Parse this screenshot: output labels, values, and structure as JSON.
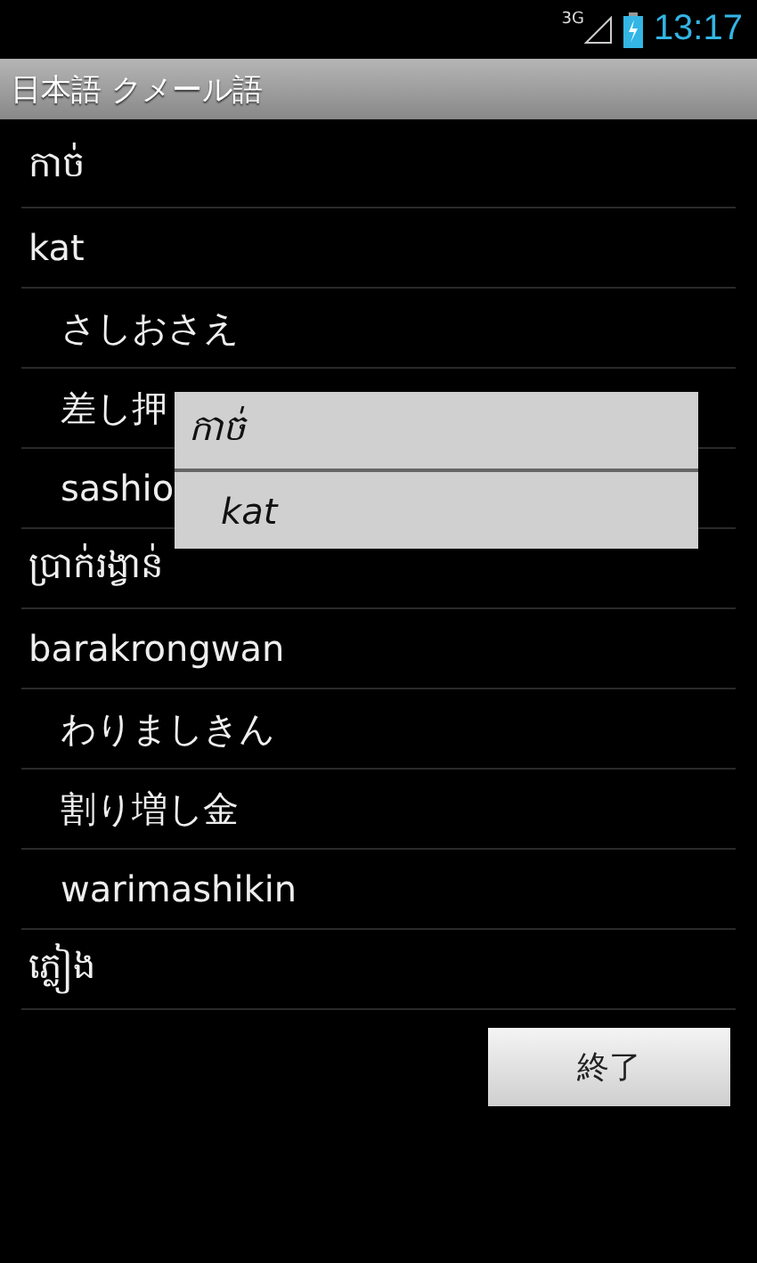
{
  "status_bar": {
    "network": "3G",
    "time": "13:17"
  },
  "title": "日本語 クメール語",
  "entries": [
    {
      "kind": "word",
      "text": "កាច់"
    },
    {
      "kind": "word",
      "text": "kat"
    },
    {
      "kind": "sub",
      "text": "さしおさえ"
    },
    {
      "kind": "sub",
      "text": "差し押"
    },
    {
      "kind": "sub",
      "text": "sashio"
    },
    {
      "kind": "word",
      "text": "ប្រាក់រង្វាន់"
    },
    {
      "kind": "word",
      "text": "barakrongwan"
    },
    {
      "kind": "sub",
      "text": "わりましきん"
    },
    {
      "kind": "sub",
      "text": "割り増し金"
    },
    {
      "kind": "sub",
      "text": "warimashikin"
    },
    {
      "kind": "word",
      "text": "ភ្លៀង"
    }
  ],
  "popup": [
    {
      "kind": "word",
      "text": "កាច់"
    },
    {
      "kind": "sub",
      "text": "kat"
    }
  ],
  "button": "終了"
}
